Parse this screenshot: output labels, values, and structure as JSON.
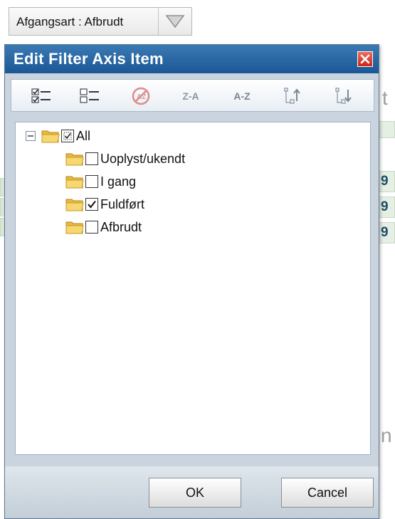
{
  "filter_chip": {
    "label": "Afgangsart : Afbrudt"
  },
  "background": {
    "row_values": [
      "9",
      "9",
      "9"
    ],
    "letter_top": "t",
    "letter_bottom": "n"
  },
  "dialog": {
    "title": "Edit Filter Axis Item",
    "toolbar": {
      "check_all": "check-all-icon",
      "uncheck_all": "uncheck-all-icon",
      "clear_sort": "clear-sort-icon",
      "sort_za": "Z-A",
      "sort_az": "A-Z",
      "move_up": "move-up-icon",
      "move_down": "move-down-icon"
    },
    "tree": {
      "root": {
        "label": "All",
        "state": "partial"
      },
      "items": [
        {
          "label": "Uoplyst/ukendt",
          "checked": false
        },
        {
          "label": "I gang",
          "checked": false
        },
        {
          "label": "Fuldført",
          "checked": true
        },
        {
          "label": "Afbrudt",
          "checked": false
        }
      ]
    },
    "buttons": {
      "ok": "OK",
      "cancel": "Cancel"
    }
  },
  "colors": {
    "title_bar": "#1b5795",
    "close": "#c8261a",
    "dialog_bg": "#c9d4de"
  }
}
